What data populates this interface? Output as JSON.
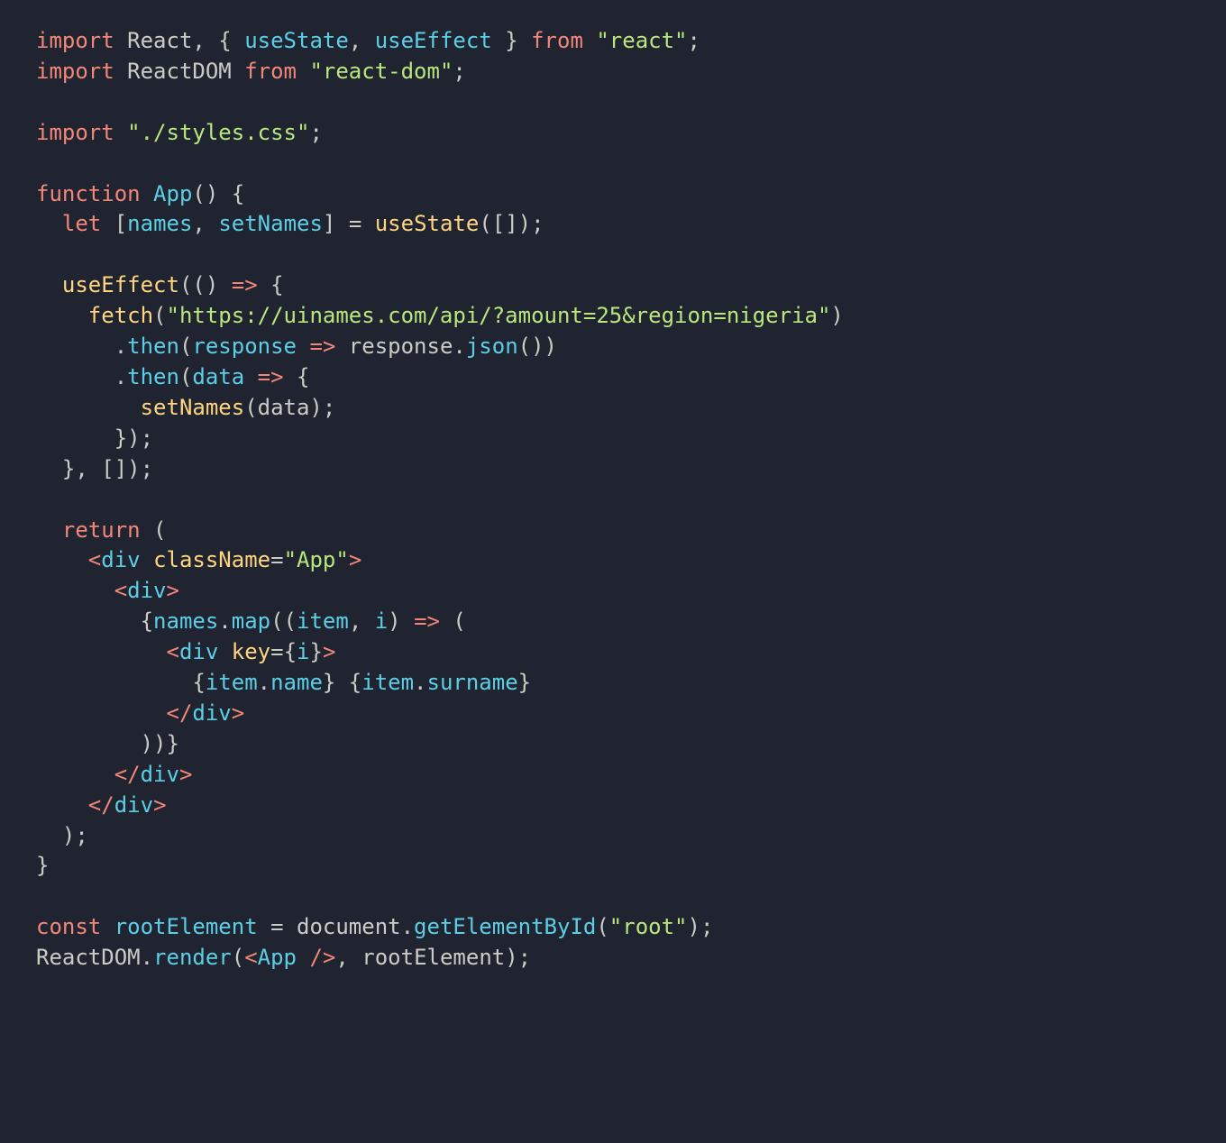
{
  "code": {
    "language": "jsx",
    "theme": "ayu-mirage",
    "lines": [
      {
        "n": 1,
        "tokens": [
          {
            "t": "import",
            "c": "keyword"
          },
          {
            "t": " ",
            "c": "default"
          },
          {
            "t": "React",
            "c": "default"
          },
          {
            "t": ", { ",
            "c": "default"
          },
          {
            "t": "useState",
            "c": "ident"
          },
          {
            "t": ", ",
            "c": "default"
          },
          {
            "t": "useEffect",
            "c": "ident"
          },
          {
            "t": " } ",
            "c": "default"
          },
          {
            "t": "from",
            "c": "keyword"
          },
          {
            "t": " ",
            "c": "default"
          },
          {
            "t": "\"react\"",
            "c": "string"
          },
          {
            "t": ";",
            "c": "default"
          }
        ]
      },
      {
        "n": 2,
        "tokens": [
          {
            "t": "import",
            "c": "keyword"
          },
          {
            "t": " ",
            "c": "default"
          },
          {
            "t": "ReactDOM",
            "c": "default"
          },
          {
            "t": " ",
            "c": "default"
          },
          {
            "t": "from",
            "c": "keyword"
          },
          {
            "t": " ",
            "c": "default"
          },
          {
            "t": "\"react-dom\"",
            "c": "string"
          },
          {
            "t": ";",
            "c": "default"
          }
        ]
      },
      {
        "n": 3,
        "tokens": []
      },
      {
        "n": 4,
        "tokens": [
          {
            "t": "import",
            "c": "keyword"
          },
          {
            "t": " ",
            "c": "default"
          },
          {
            "t": "\"./styles.css\"",
            "c": "string"
          },
          {
            "t": ";",
            "c": "default"
          }
        ]
      },
      {
        "n": 5,
        "tokens": []
      },
      {
        "n": 6,
        "tokens": [
          {
            "t": "function",
            "c": "keyword"
          },
          {
            "t": " ",
            "c": "default"
          },
          {
            "t": "App",
            "c": "ident"
          },
          {
            "t": "() {",
            "c": "default"
          }
        ]
      },
      {
        "n": 7,
        "tokens": [
          {
            "t": "  ",
            "c": "default"
          },
          {
            "t": "let",
            "c": "keyword"
          },
          {
            "t": " [",
            "c": "default"
          },
          {
            "t": "names",
            "c": "ident"
          },
          {
            "t": ", ",
            "c": "default"
          },
          {
            "t": "setNames",
            "c": "ident"
          },
          {
            "t": "] = ",
            "c": "default"
          },
          {
            "t": "useState",
            "c": "func"
          },
          {
            "t": "([]);",
            "c": "default"
          }
        ]
      },
      {
        "n": 8,
        "tokens": []
      },
      {
        "n": 9,
        "tokens": [
          {
            "t": "  ",
            "c": "default"
          },
          {
            "t": "useEffect",
            "c": "func"
          },
          {
            "t": "(() ",
            "c": "default"
          },
          {
            "t": "=>",
            "c": "arrow"
          },
          {
            "t": " {",
            "c": "default"
          }
        ]
      },
      {
        "n": 10,
        "tokens": [
          {
            "t": "    ",
            "c": "default"
          },
          {
            "t": "fetch",
            "c": "func"
          },
          {
            "t": "(",
            "c": "default"
          },
          {
            "t": "\"https://uinames.com/api/?amount=25&region=nigeria\"",
            "c": "string"
          },
          {
            "t": ")",
            "c": "default"
          }
        ]
      },
      {
        "n": 11,
        "tokens": [
          {
            "t": "      .",
            "c": "default"
          },
          {
            "t": "then",
            "c": "method"
          },
          {
            "t": "(",
            "c": "default"
          },
          {
            "t": "response",
            "c": "ident"
          },
          {
            "t": " ",
            "c": "default"
          },
          {
            "t": "=>",
            "c": "arrow"
          },
          {
            "t": " response.",
            "c": "default"
          },
          {
            "t": "json",
            "c": "method"
          },
          {
            "t": "())",
            "c": "default"
          }
        ]
      },
      {
        "n": 12,
        "tokens": [
          {
            "t": "      .",
            "c": "default"
          },
          {
            "t": "then",
            "c": "method"
          },
          {
            "t": "(",
            "c": "default"
          },
          {
            "t": "data",
            "c": "ident"
          },
          {
            "t": " ",
            "c": "default"
          },
          {
            "t": "=>",
            "c": "arrow"
          },
          {
            "t": " {",
            "c": "default"
          }
        ]
      },
      {
        "n": 13,
        "tokens": [
          {
            "t": "        ",
            "c": "default"
          },
          {
            "t": "setNames",
            "c": "func"
          },
          {
            "t": "(data);",
            "c": "default"
          }
        ]
      },
      {
        "n": 14,
        "tokens": [
          {
            "t": "      });",
            "c": "default"
          }
        ]
      },
      {
        "n": 15,
        "tokens": [
          {
            "t": "  }, []);",
            "c": "default"
          }
        ]
      },
      {
        "n": 16,
        "tokens": []
      },
      {
        "n": 17,
        "tokens": [
          {
            "t": "  ",
            "c": "default"
          },
          {
            "t": "return",
            "c": "keyword"
          },
          {
            "t": " (",
            "c": "default"
          }
        ]
      },
      {
        "n": 18,
        "tokens": [
          {
            "t": "    ",
            "c": "default"
          },
          {
            "t": "<",
            "c": "tag"
          },
          {
            "t": "div",
            "c": "tagname"
          },
          {
            "t": " ",
            "c": "default"
          },
          {
            "t": "className",
            "c": "attr2"
          },
          {
            "t": "=",
            "c": "default"
          },
          {
            "t": "\"App\"",
            "c": "string"
          },
          {
            "t": ">",
            "c": "tag"
          }
        ]
      },
      {
        "n": 19,
        "tokens": [
          {
            "t": "      ",
            "c": "default"
          },
          {
            "t": "<",
            "c": "tag"
          },
          {
            "t": "div",
            "c": "tagname"
          },
          {
            "t": ">",
            "c": "tag"
          }
        ]
      },
      {
        "n": 20,
        "tokens": [
          {
            "t": "        {",
            "c": "default"
          },
          {
            "t": "names",
            "c": "ident"
          },
          {
            "t": ".",
            "c": "default"
          },
          {
            "t": "map",
            "c": "method"
          },
          {
            "t": "((",
            "c": "default"
          },
          {
            "t": "item",
            "c": "ident"
          },
          {
            "t": ", ",
            "c": "default"
          },
          {
            "t": "i",
            "c": "ident"
          },
          {
            "t": ") ",
            "c": "default"
          },
          {
            "t": "=>",
            "c": "arrow"
          },
          {
            "t": " (",
            "c": "default"
          }
        ]
      },
      {
        "n": 21,
        "tokens": [
          {
            "t": "          ",
            "c": "default"
          },
          {
            "t": "<",
            "c": "tag"
          },
          {
            "t": "div",
            "c": "tagname"
          },
          {
            "t": " ",
            "c": "default"
          },
          {
            "t": "key",
            "c": "attr2"
          },
          {
            "t": "={",
            "c": "default"
          },
          {
            "t": "i",
            "c": "ident"
          },
          {
            "t": "}",
            "c": "default"
          },
          {
            "t": ">",
            "c": "tag"
          }
        ]
      },
      {
        "n": 22,
        "tokens": [
          {
            "t": "            {",
            "c": "default"
          },
          {
            "t": "item",
            "c": "ident"
          },
          {
            "t": ".",
            "c": "default"
          },
          {
            "t": "name",
            "c": "prop"
          },
          {
            "t": "} {",
            "c": "default"
          },
          {
            "t": "item",
            "c": "ident"
          },
          {
            "t": ".",
            "c": "default"
          },
          {
            "t": "surname",
            "c": "prop"
          },
          {
            "t": "}",
            "c": "default"
          }
        ]
      },
      {
        "n": 23,
        "tokens": [
          {
            "t": "          ",
            "c": "default"
          },
          {
            "t": "</",
            "c": "tag"
          },
          {
            "t": "div",
            "c": "tagname"
          },
          {
            "t": ">",
            "c": "tag"
          }
        ]
      },
      {
        "n": 24,
        "tokens": [
          {
            "t": "        ))}",
            "c": "default"
          }
        ]
      },
      {
        "n": 25,
        "tokens": [
          {
            "t": "      ",
            "c": "default"
          },
          {
            "t": "</",
            "c": "tag"
          },
          {
            "t": "div",
            "c": "tagname"
          },
          {
            "t": ">",
            "c": "tag"
          }
        ]
      },
      {
        "n": 26,
        "tokens": [
          {
            "t": "    ",
            "c": "default"
          },
          {
            "t": "</",
            "c": "tag"
          },
          {
            "t": "div",
            "c": "tagname"
          },
          {
            "t": ">",
            "c": "tag"
          }
        ]
      },
      {
        "n": 27,
        "tokens": [
          {
            "t": "  );",
            "c": "default"
          }
        ]
      },
      {
        "n": 28,
        "tokens": [
          {
            "t": "}",
            "c": "default"
          }
        ]
      },
      {
        "n": 29,
        "tokens": []
      },
      {
        "n": 30,
        "tokens": [
          {
            "t": "const",
            "c": "keyword"
          },
          {
            "t": " ",
            "c": "default"
          },
          {
            "t": "rootElement",
            "c": "ident"
          },
          {
            "t": " = document.",
            "c": "default"
          },
          {
            "t": "getElementById",
            "c": "method"
          },
          {
            "t": "(",
            "c": "default"
          },
          {
            "t": "\"root\"",
            "c": "string"
          },
          {
            "t": ");",
            "c": "default"
          }
        ]
      },
      {
        "n": 31,
        "tokens": [
          {
            "t": "ReactDOM.",
            "c": "default"
          },
          {
            "t": "render",
            "c": "method"
          },
          {
            "t": "(",
            "c": "default"
          },
          {
            "t": "<",
            "c": "tag"
          },
          {
            "t": "App",
            "c": "tagname"
          },
          {
            "t": " ",
            "c": "default"
          },
          {
            "t": "/>",
            "c": "tag"
          },
          {
            "t": ", rootElement);",
            "c": "default"
          }
        ]
      }
    ]
  }
}
